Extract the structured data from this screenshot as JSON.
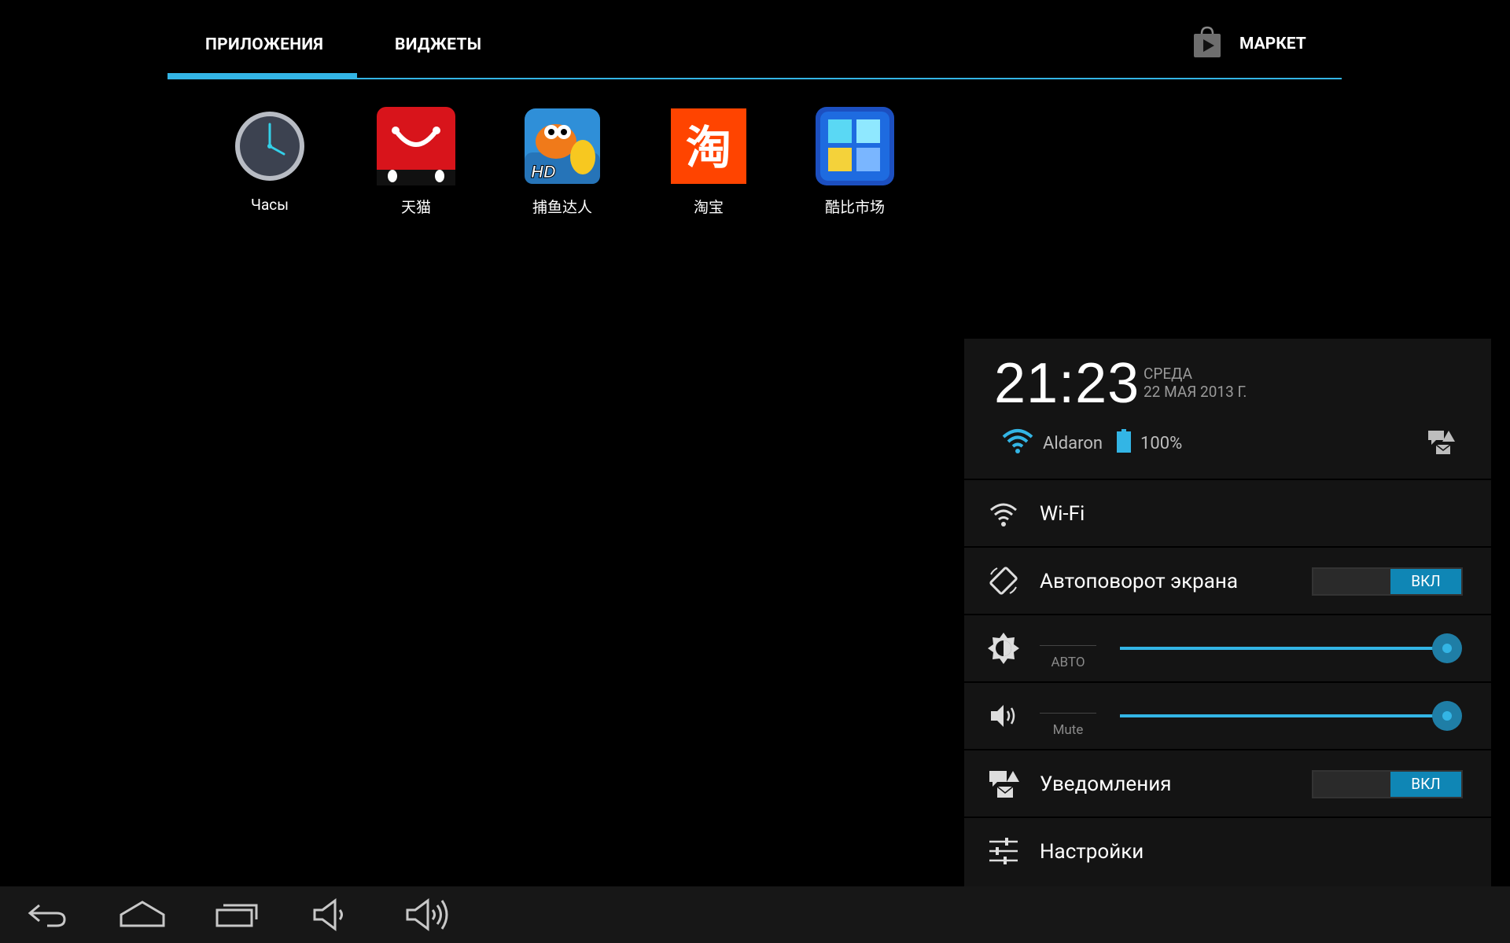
{
  "tabs": {
    "apps": "ПРИЛОЖЕНИЯ",
    "widgets": "ВИДЖЕТЫ",
    "market": "МАРКЕТ"
  },
  "apps": [
    {
      "label": "Часы",
      "icon": "clock-icon"
    },
    {
      "label": "天猫",
      "icon": "tmall-icon"
    },
    {
      "label": "捕鱼达人",
      "icon": "fishing-game-icon"
    },
    {
      "label": "淘宝",
      "icon": "taobao-icon"
    },
    {
      "label": "酷比市场",
      "icon": "coobee-market-icon"
    }
  ],
  "panel": {
    "time": "21:23",
    "day": "СРЕДА",
    "date": "22 МАЯ 2013 Г.",
    "network": "Aldaron",
    "battery": "100%",
    "wifi_label": "Wi-Fi",
    "autorotate_label": "Автоповорот экрана",
    "autorotate_state": "ВКЛ",
    "brightness_auto": "АВТО",
    "brightness_level": 1.0,
    "volume_mute": "Mute",
    "volume_level": 1.0,
    "notifications_label": "Уведомления",
    "notifications_state": "ВКЛ",
    "settings_label": "Настройки"
  },
  "colors": {
    "accent": "#33b5e5",
    "toggle_on": "#0f86b5",
    "panel_bg": "#141414",
    "navbar_bg": "#171717"
  }
}
